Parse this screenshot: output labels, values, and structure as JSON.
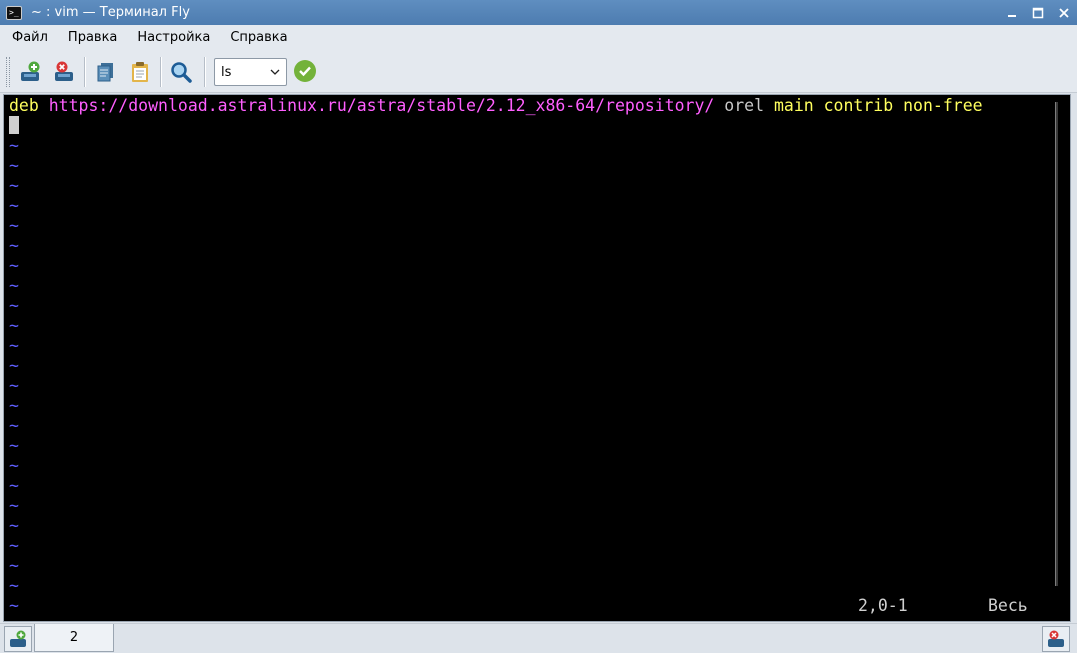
{
  "window": {
    "title": "~ : vim — Терминал Fly",
    "icon": "terminal-icon",
    "controls": [
      "minimize-icon",
      "maximize-icon",
      "close-icon"
    ]
  },
  "menu": {
    "items": [
      "Файл",
      "Правка",
      "Настройка",
      "Справка"
    ]
  },
  "toolbar": {
    "buttons": [
      "new-tab-icon",
      "close-tab-icon",
      "copy-icon",
      "paste-icon",
      "search-icon"
    ],
    "command_value": "ls",
    "run_button": "run-icon"
  },
  "terminal": {
    "first_line": {
      "deb": "deb",
      "url": "https://download.astralinux.ru/astra/stable/2.12_x86-64/repository/",
      "dist": "orel",
      "components": "main contrib non-free"
    },
    "tilde": "~",
    "tilde_rows": 24,
    "status_position": "2,0-1",
    "status_view": "Весь",
    "colors": {
      "keyword": "#ffff5f",
      "url": "#ff5fff",
      "tilde": "#5f5fff",
      "background": "#000000"
    }
  },
  "tabs": {
    "items": [
      "2"
    ]
  }
}
